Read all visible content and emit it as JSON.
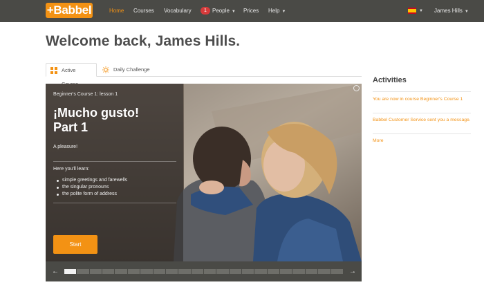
{
  "nav": {
    "logo": "+Babbel",
    "items": [
      {
        "label": "Home",
        "active": true
      },
      {
        "label": "Courses"
      },
      {
        "label": "Vocabulary"
      },
      {
        "label": "People",
        "badge": "1"
      },
      {
        "label": "Prices"
      },
      {
        "label": "Help"
      }
    ],
    "user": "James Hills",
    "accent": "#f39214"
  },
  "page": {
    "title": "Welcome back, James Hills."
  },
  "tabs": [
    {
      "label": "Active Course",
      "icon": "grid-icon"
    },
    {
      "label": "Daily Challenge",
      "icon": "sun-icon"
    }
  ],
  "course": {
    "lesson_label": "Beginner's Course 1: lesson 1",
    "title_line1": "¡Mucho gusto!",
    "title_line2": "Part 1",
    "subtitle": "A pleasure!",
    "learn_label": "Here you'll learn:",
    "learn_items": [
      "simple greetings and farewells",
      "the singular pronouns",
      "the polite form of address"
    ],
    "start_label": "Start",
    "progress": {
      "completed_segments": 1,
      "total_segments": 22
    }
  },
  "activities": {
    "title": "Activities",
    "items": [
      {
        "prefix": "You are now in course ",
        "link": "Beginner's Course 1",
        "suffix": ""
      },
      {
        "prefix": "",
        "link": "Babbel Customer Service",
        "suffix": " sent you a message."
      }
    ],
    "more": "More"
  }
}
